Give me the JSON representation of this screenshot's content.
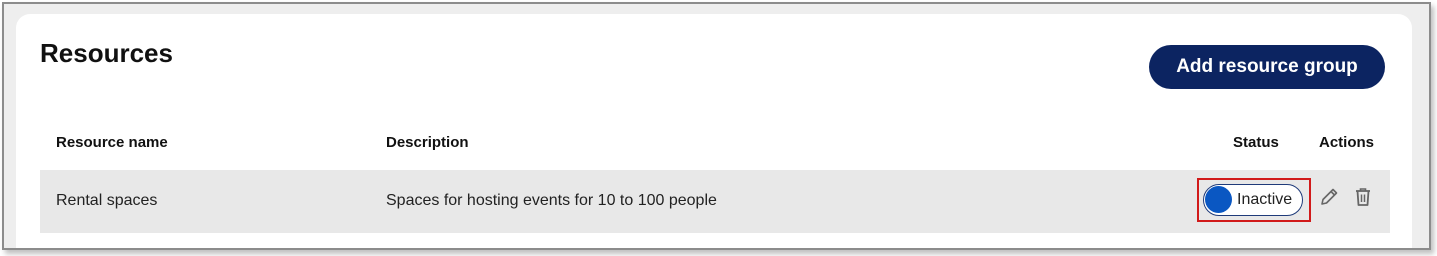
{
  "header": {
    "title": "Resources",
    "add_button_label": "Add resource group"
  },
  "table": {
    "columns": {
      "name": "Resource name",
      "description": "Description",
      "status": "Status",
      "actions": "Actions"
    },
    "rows": [
      {
        "name": "Rental spaces",
        "description": "Spaces for hosting events for 10 to 100 people",
        "status": "Inactive",
        "status_active": false,
        "actions": [
          "pencil-icon",
          "trash-icon"
        ]
      }
    ]
  },
  "colors": {
    "primary_button": "#0c2461",
    "toggle_knob": "#0a57c2",
    "highlight_border": "#d11a1a",
    "row_background": "#e8e8e8"
  }
}
